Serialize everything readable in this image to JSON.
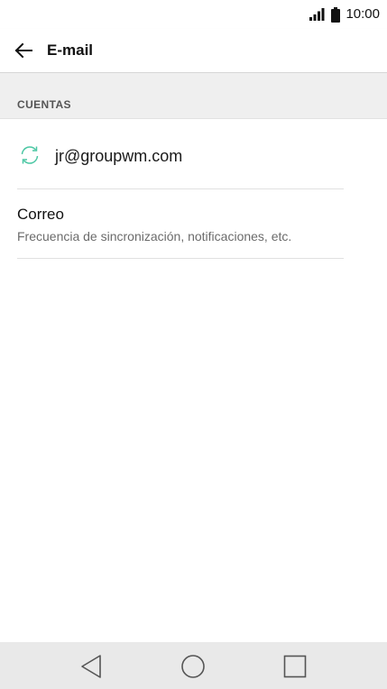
{
  "status_bar": {
    "time": "10:00",
    "icons": [
      "signal-icon",
      "battery-icon"
    ]
  },
  "app_bar": {
    "back_icon": "arrow-left-icon",
    "title": "E-mail"
  },
  "section": {
    "title": "CUENTAS"
  },
  "accounts": [
    {
      "icon": "sync-icon",
      "email": "jr@groupwm.com"
    }
  ],
  "settings": {
    "mail": {
      "title": "Correo",
      "subtitle": "Frecuencia de sincronización, notificaciones, etc."
    }
  },
  "nav_bar": {
    "buttons": [
      "back-triangle-icon",
      "home-circle-icon",
      "recents-square-icon"
    ]
  },
  "colors": {
    "accent": "#4cc7a4",
    "section_background": "#efefef",
    "nav_background": "#e9e9e9",
    "divider": "#e0e0e0"
  }
}
